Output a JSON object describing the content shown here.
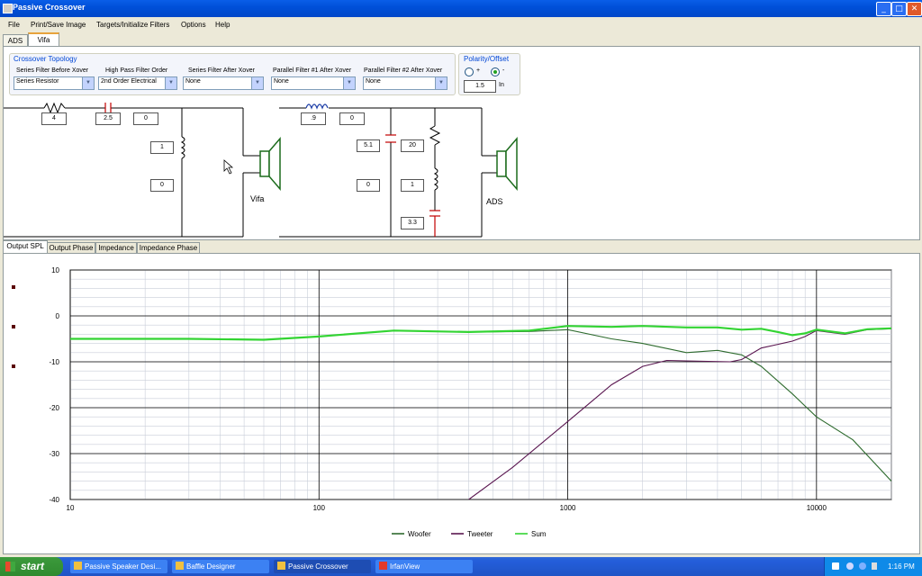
{
  "window": {
    "title": "Passive Crossover",
    "minimize": "_",
    "maximize": "□",
    "close": "✕"
  },
  "menu": [
    "File",
    "Print/Save Image",
    "Targets/Initialize Filters",
    "Options",
    "Help"
  ],
  "driver_tabs": [
    "ADS",
    "Vifa"
  ],
  "topology": {
    "title": "Crossover Topology",
    "fields": [
      {
        "label": "Series Filter Before Xover",
        "value": "Series Resistor"
      },
      {
        "label": "High Pass Filter Order",
        "value": "2nd Order Electrical"
      },
      {
        "label": "Series Filter After Xover",
        "value": "None"
      },
      {
        "label": "Parallel Filter #1 After Xover",
        "value": "None"
      },
      {
        "label": "Parallel Filter #2 After Xover",
        "value": "None"
      }
    ]
  },
  "polarity": {
    "title": "Polarity/Offset",
    "plus": "+",
    "minus": "-",
    "offset_value": "1.5",
    "offset_unit": "In"
  },
  "circuit_vifa": {
    "resistor": "4",
    "capacitor": "2.5",
    "cap_extra": "0",
    "inductor": "1",
    "shunt_extra": "0",
    "driver_label": "Vifa"
  },
  "circuit_ads": {
    "inductor": ".9",
    "ind_extra": "0",
    "shunt_cap": "5.1",
    "shunt_extra": "0",
    "resistor": "20",
    "notch_inductor": "1",
    "notch_cap": "3.3",
    "driver_label": "ADS"
  },
  "plot_tabs": [
    "Output SPL",
    "Output Phase",
    "Impedance",
    "Impedance Phase"
  ],
  "chart_data": {
    "type": "line",
    "xscale": "log",
    "xlim": [
      10,
      20000
    ],
    "ylim": [
      -40,
      10
    ],
    "xticks": [
      "10",
      "100",
      "1000",
      "10000"
    ],
    "yticks": [
      "10",
      "0",
      "-10",
      "-20",
      "-30",
      "-40"
    ],
    "grid": true,
    "legend": "bottom-center",
    "series": [
      {
        "name": "Woofer",
        "color": "#2e6b2e",
        "points": [
          [
            10,
            -5
          ],
          [
            30,
            -5
          ],
          [
            60,
            -5.2
          ],
          [
            100,
            -4.5
          ],
          [
            200,
            -3.2
          ],
          [
            400,
            -3.5
          ],
          [
            700,
            -3.4
          ],
          [
            1000,
            -3
          ],
          [
            1500,
            -5
          ],
          [
            2000,
            -6
          ],
          [
            3000,
            -8
          ],
          [
            4000,
            -7.5
          ],
          [
            5000,
            -8.5
          ],
          [
            6000,
            -11
          ],
          [
            8000,
            -17
          ],
          [
            10000,
            -22
          ],
          [
            14000,
            -27
          ],
          [
            20000,
            -36
          ]
        ]
      },
      {
        "name": "Tweeter",
        "color": "#5a1650",
        "points": [
          [
            400,
            -40
          ],
          [
            600,
            -33
          ],
          [
            1000,
            -23
          ],
          [
            1500,
            -15
          ],
          [
            2000,
            -11
          ],
          [
            2500,
            -9.7
          ],
          [
            3000,
            -9.8
          ],
          [
            4500,
            -10
          ],
          [
            5000,
            -9.5
          ],
          [
            6000,
            -7
          ],
          [
            7000,
            -6.2
          ],
          [
            8000,
            -5.5
          ],
          [
            9000,
            -4.5
          ],
          [
            10000,
            -3.2
          ],
          [
            13000,
            -4
          ],
          [
            16000,
            -3
          ],
          [
            20000,
            -2.8
          ]
        ]
      },
      {
        "name": "Sum",
        "color": "#33d433",
        "points": [
          [
            10,
            -5
          ],
          [
            30,
            -5
          ],
          [
            60,
            -5.2
          ],
          [
            100,
            -4.5
          ],
          [
            200,
            -3.2
          ],
          [
            400,
            -3.5
          ],
          [
            700,
            -3.2
          ],
          [
            1000,
            -2.2
          ],
          [
            1500,
            -2.4
          ],
          [
            2000,
            -2.2
          ],
          [
            3000,
            -2.5
          ],
          [
            4000,
            -2.5
          ],
          [
            5000,
            -3
          ],
          [
            6000,
            -2.8
          ],
          [
            7000,
            -3.5
          ],
          [
            8000,
            -4.2
          ],
          [
            9000,
            -3.8
          ],
          [
            10000,
            -3
          ],
          [
            13000,
            -3.8
          ],
          [
            16000,
            -2.9
          ],
          [
            20000,
            -2.7
          ]
        ]
      }
    ]
  },
  "taskbar": {
    "start": "start",
    "items": [
      "Passive Speaker Desi...",
      "Baffle Designer",
      "Passive Crossover",
      "IrfanView"
    ],
    "clock": "1:16 PM"
  }
}
